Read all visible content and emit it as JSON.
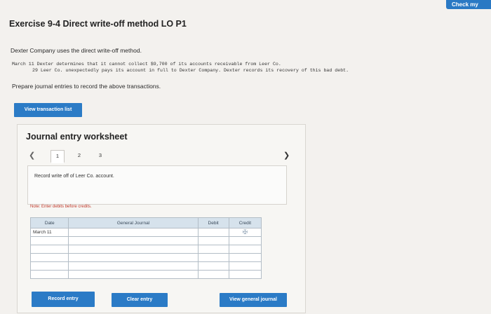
{
  "header": {
    "check_button_label": "Check my"
  },
  "exercise": {
    "title": "Exercise 9-4 Direct write-off method LO P1",
    "intro": "Dexter Company uses the direct write-off method.",
    "line1": "March 11 Dexter determines that it cannot collect $9,700 of its accounts receivable from Leer Co.",
    "line2": "29 Leer Co. unexpectedly pays its account in full to Dexter Company. Dexter records its recovery of this bad debt.",
    "prompt": "Prepare journal entries to record the above transactions."
  },
  "buttons": {
    "view_transaction_list": "View transaction list",
    "record_entry": "Record entry",
    "clear_entry": "Clear entry",
    "view_general_journal": "View general journal"
  },
  "worksheet": {
    "title": "Journal entry worksheet",
    "pages": [
      "1",
      "2",
      "3"
    ],
    "active_page": "1",
    "instruction": "Record write off of Leer Co. account.",
    "note": "Note: Enter debits before credits."
  },
  "journal": {
    "headers": {
      "date": "Date",
      "general_journal": "General Journal",
      "debit": "Debit",
      "credit": "Credit"
    },
    "rows": [
      {
        "date": "March 11",
        "account": "",
        "debit": "",
        "credit": ""
      },
      {
        "date": "",
        "account": "",
        "debit": "",
        "credit": ""
      },
      {
        "date": "",
        "account": "",
        "debit": "",
        "credit": ""
      },
      {
        "date": "",
        "account": "",
        "debit": "",
        "credit": ""
      },
      {
        "date": "",
        "account": "",
        "debit": "",
        "credit": ""
      },
      {
        "date": "",
        "account": "",
        "debit": "",
        "credit": ""
      }
    ]
  },
  "icons": {
    "prev": "chevron-left-icon",
    "next": "chevron-right-icon",
    "cursor": "move-cursor-icon"
  },
  "colors": {
    "accent": "#2b7bc6",
    "note": "#c0392b",
    "table_header": "#d6e2ec"
  }
}
